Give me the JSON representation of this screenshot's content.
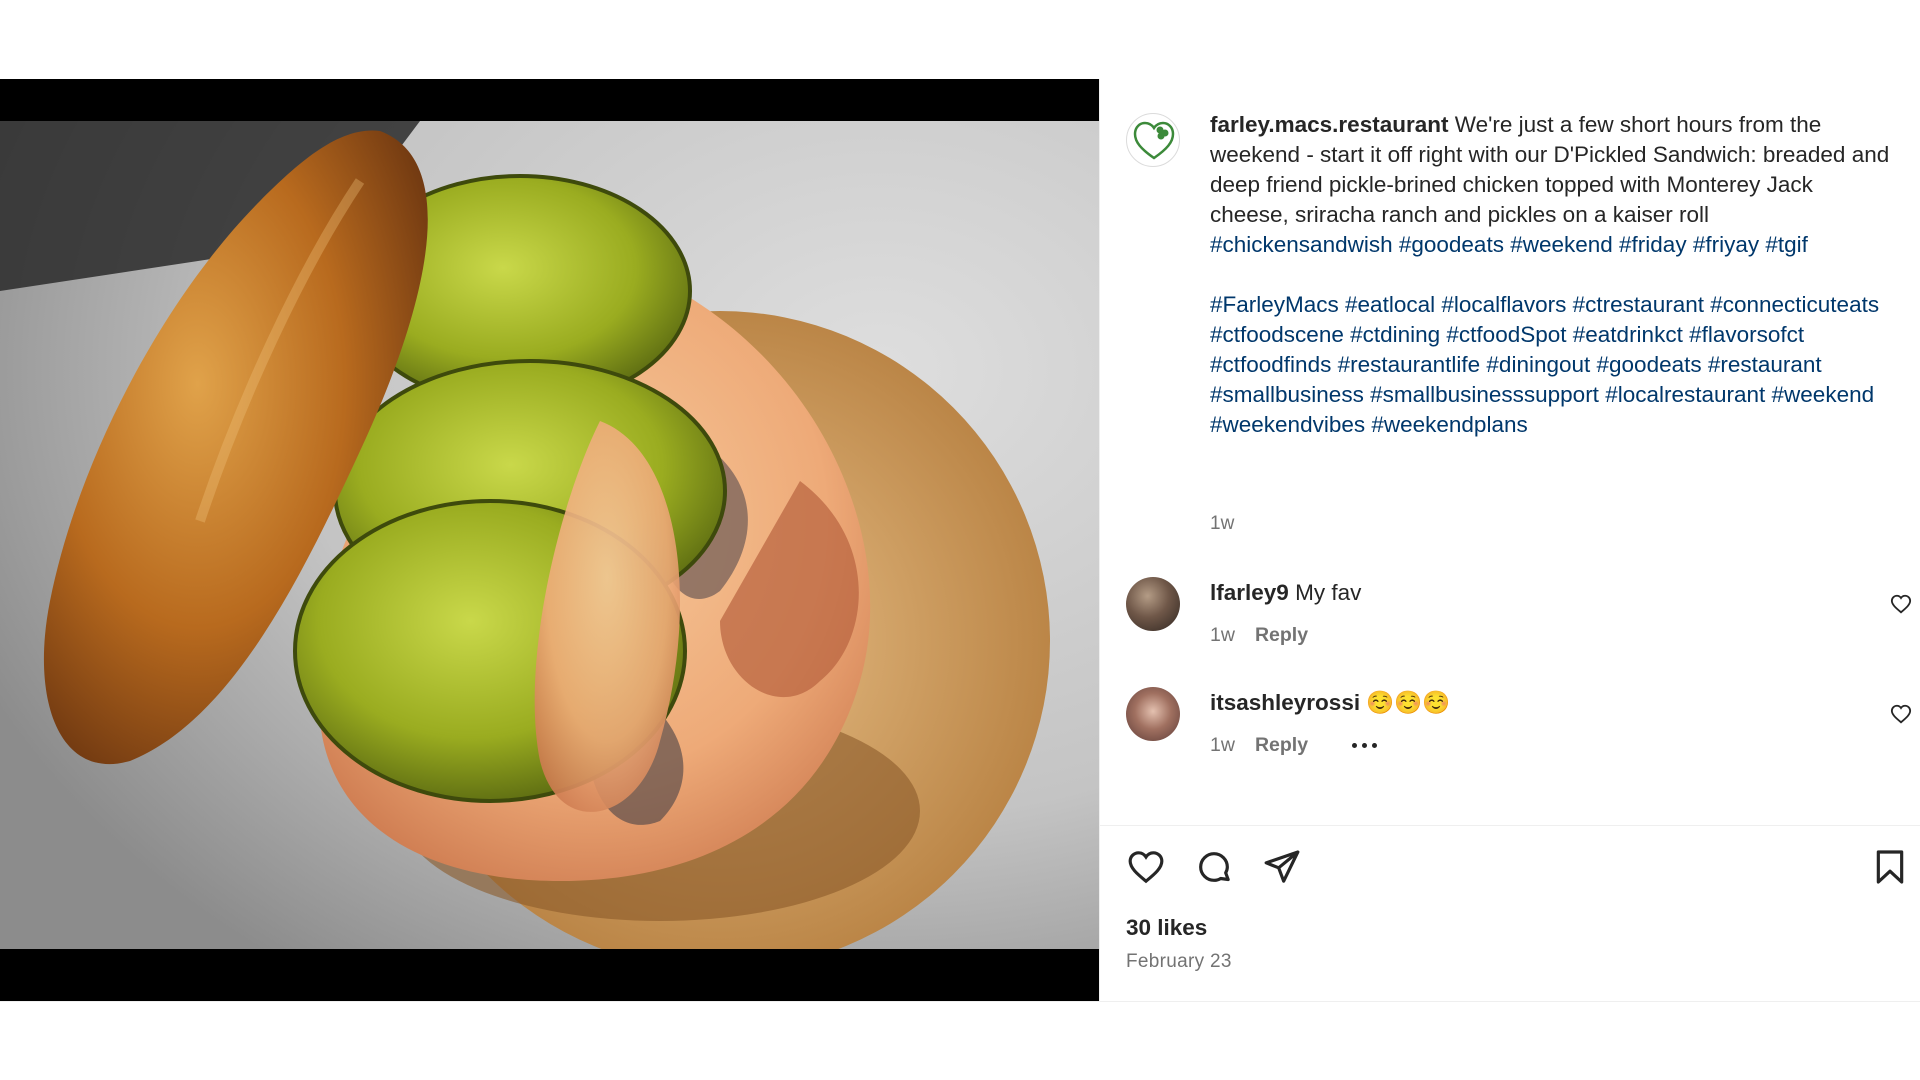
{
  "post": {
    "image_alt": "D'Pickled Sandwich with pickles and sriracha ranch",
    "username": "farley.macs.restaurant",
    "caption_text": "We're just a few short hours from the weekend - start it off right with our D'Pickled Sandwich: breaded and deep friend pickle-brined chicken topped with Monterey Jack cheese, sriracha ranch and pickles on a kaiser roll",
    "caption_tags": "#chickensandwish #goodeats #weekend #friday #friyay #tgif",
    "hashtags_block": "#FarleyMacs #eatlocal #localflavors #ctrestaurant #connecticuteats #ctfoodscene #ctdining #ctfoodSpot #eatdrinkct #flavorsofct #ctfoodfinds #restaurantlife #diningout #goodeats #restaurant #smallbusiness #smallbusinesssupport #localrestaurant #weekend #weekendvibes #weekendplans",
    "time": "1w",
    "likes": "30 likes",
    "date": "February 23"
  },
  "comments": [
    {
      "username": "lfarley9",
      "text": "My fav",
      "time": "1w",
      "reply_label": "Reply"
    },
    {
      "username": "itsashleyrossi",
      "text": "☺️☺️☺️",
      "time": "1w",
      "reply_label": "Reply"
    }
  ],
  "colors": {
    "hashtag": "#00376b",
    "muted": "#737373",
    "text": "#262626",
    "logo_green": "#3c8a3a"
  },
  "icons": [
    "heart-icon",
    "comment-icon",
    "share-icon",
    "bookmark-icon",
    "more-icon"
  ]
}
